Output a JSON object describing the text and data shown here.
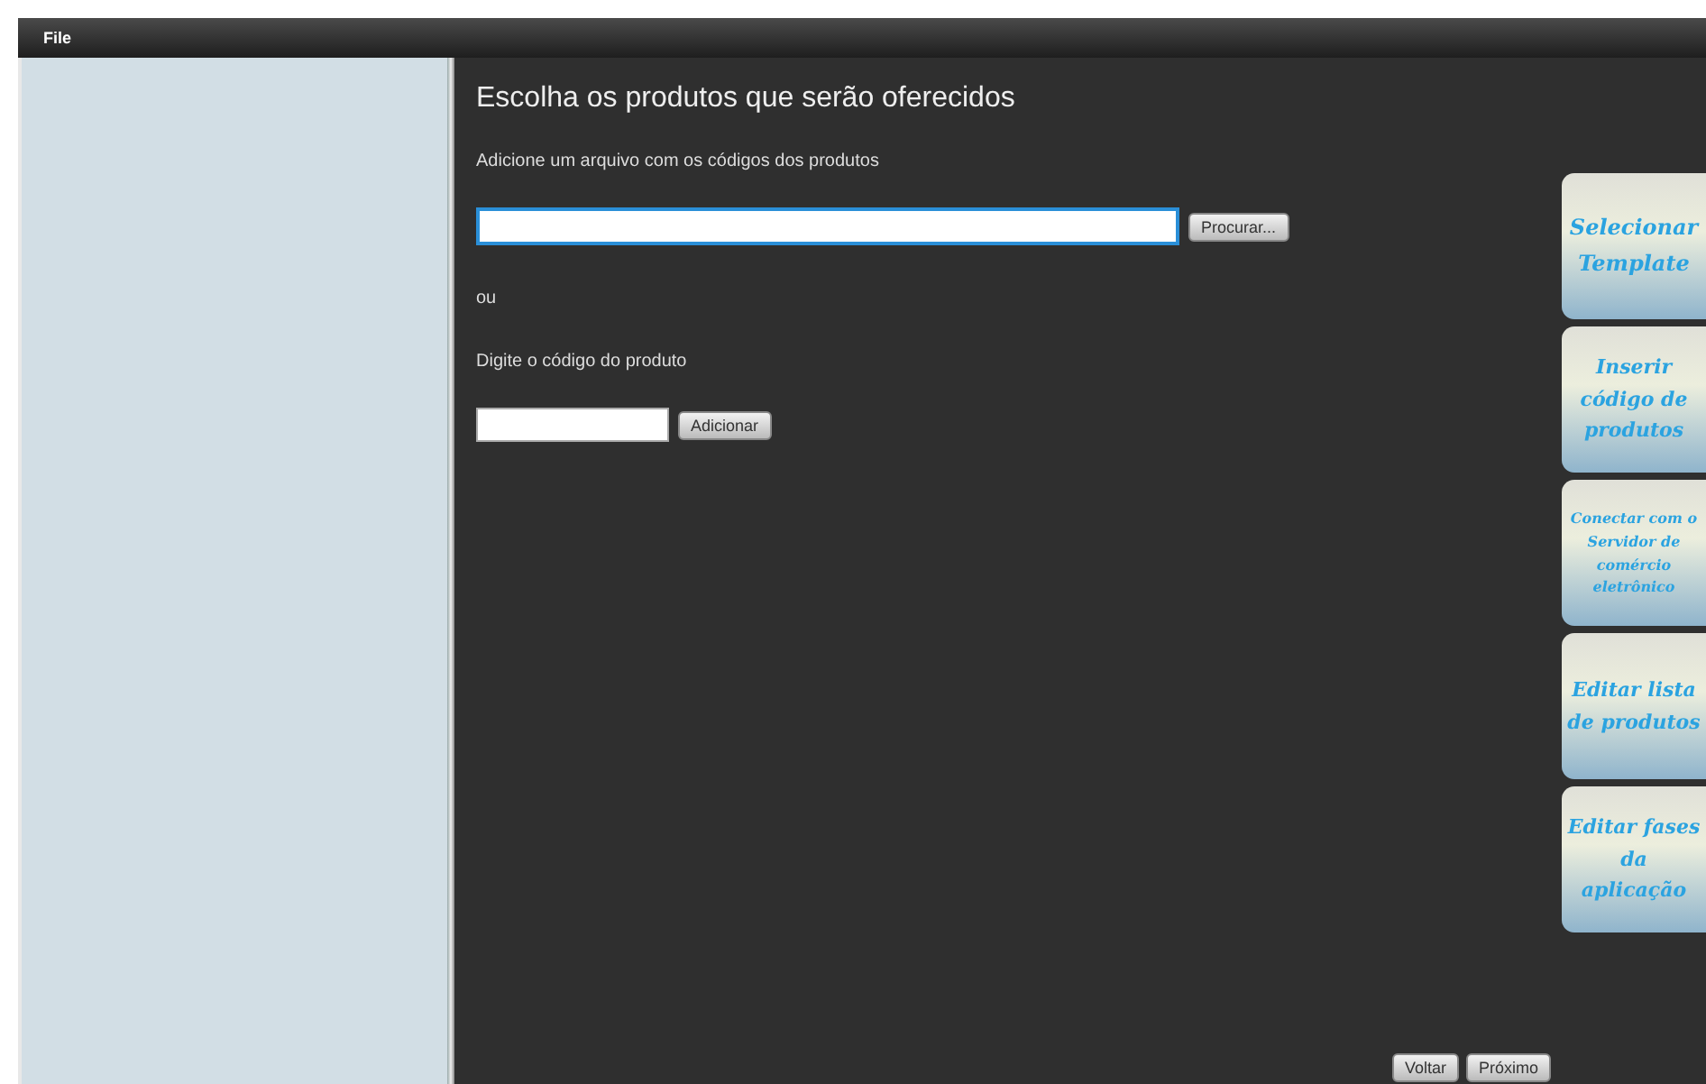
{
  "menu_bar": {
    "items": [
      "File"
    ]
  },
  "main": {
    "title": "Escolha os produtos que serão oferecidos",
    "file_label": "Adicione um arquivo com os códigos dos produtos",
    "browse_button": "Procurar...",
    "or_label": "ou",
    "code_label": "Digite o código do produto",
    "add_button": "Adicionar"
  },
  "steps": [
    {
      "label": "Selecionar Template"
    },
    {
      "label": "Inserir código de produtos"
    },
    {
      "label": "Conectar com o Servidor de comércio eletrônico"
    },
    {
      "label": "Editar lista de produtos"
    },
    {
      "label": "Editar fases da aplicação"
    }
  ],
  "footer_buttons": [
    "Voltar",
    "Próximo"
  ]
}
